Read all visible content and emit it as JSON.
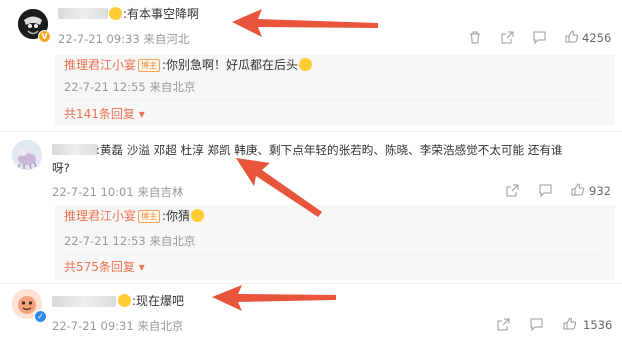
{
  "comments": [
    {
      "text": ":有本事空降啊",
      "meta": "22-7-21 09:33 来自河北",
      "likes": "4256",
      "reply": {
        "author": "推理君江小宴",
        "tag": "博主",
        "text": ":你别急啊！好瓜都在后头",
        "meta": "22-7-21 12:55 来自北京",
        "more": "共141条回复 ▾"
      }
    },
    {
      "text": ":黄磊 沙溢 邓超 杜淳 郑凯 韩庚、剩下点年轻的张若昀、陈晓、李荣浩感觉不太可能 还有谁",
      "text2": "呀?",
      "meta": "22-7-21 10:01 来自吉林",
      "likes": "932",
      "reply": {
        "author": "推理君江小宴",
        "tag": "博主",
        "text": ":你猜",
        "meta": "22-7-21 12:53 来自北京",
        "more": "共575条回复 ▾"
      }
    },
    {
      "text": ":现在爆吧",
      "meta": "22-7-21 09:31 来自北京",
      "likes": "1536"
    }
  ],
  "icons": {
    "delete": "trash-icon",
    "share": "share-icon",
    "comment": "comment-icon",
    "like": "thumbs-up-icon"
  },
  "colors": {
    "annotation_arrow": "#e8553a",
    "author_link": "#eb7350",
    "meta_text": "#999999"
  }
}
